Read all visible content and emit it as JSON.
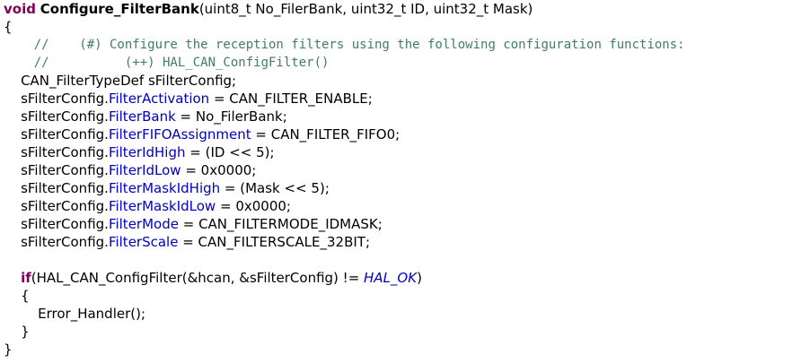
{
  "code": {
    "l1_kw": "void",
    "l1_fn": "Configure_FilterBank",
    "l1_rest": "(uint8_t No_FilerBank, uint32_t ID, uint32_t Mask)",
    "l2": "{",
    "l3": "    //    (#) Configure the reception filters using the following configuration functions:",
    "l4": "    //          (++) HAL_CAN_ConfigFilter()",
    "l5": "    CAN_FilterTypeDef sFilterConfig;",
    "l6_obj": "    sFilterConfig.",
    "l6_fld": "FilterActivation",
    "l6_rest": " = CAN_FILTER_ENABLE;",
    "l7_obj": "    sFilterConfig.",
    "l7_fld": "FilterBank",
    "l7_rest": " = No_FilerBank;",
    "l8_obj": "    sFilterConfig.",
    "l8_fld": "FilterFIFOAssignment",
    "l8_rest": " = CAN_FILTER_FIFO0;",
    "l9_obj": "    sFilterConfig.",
    "l9_fld": "FilterIdHigh",
    "l9_rest": " = (ID << 5);",
    "l10_obj": "    sFilterConfig.",
    "l10_fld": "FilterIdLow",
    "l10_rest": " = 0x0000;",
    "l11_obj": "    sFilterConfig.",
    "l11_fld": "FilterMaskIdHigh",
    "l11_rest": " = (Mask << 5);",
    "l12_obj": "    sFilterConfig.",
    "l12_fld": "FilterMaskIdLow",
    "l12_rest": " = 0x0000;",
    "l13_obj": "    sFilterConfig.",
    "l13_fld": "FilterMode",
    "l13_rest": " = CAN_FILTERMODE_IDMASK;",
    "l14_obj": "    sFilterConfig.",
    "l14_fld": "FilterScale",
    "l14_rest": " = CAN_FILTERSCALE_32BIT;",
    "l16_indent": "    ",
    "l16_kw": "if",
    "l16_mid": "(HAL_CAN_ConfigFilter(&hcan, &sFilterConfig) != ",
    "l16_const": "HAL_OK",
    "l16_end": ")",
    "l17": "    {",
    "l18": "        Error_Handler();",
    "l19": "    }",
    "l20": "}"
  },
  "colors": {
    "keyword": "#7f0055",
    "comment": "#3f7f5f",
    "field": "#0000c0",
    "text": "#000000",
    "background": "#ffffff"
  }
}
